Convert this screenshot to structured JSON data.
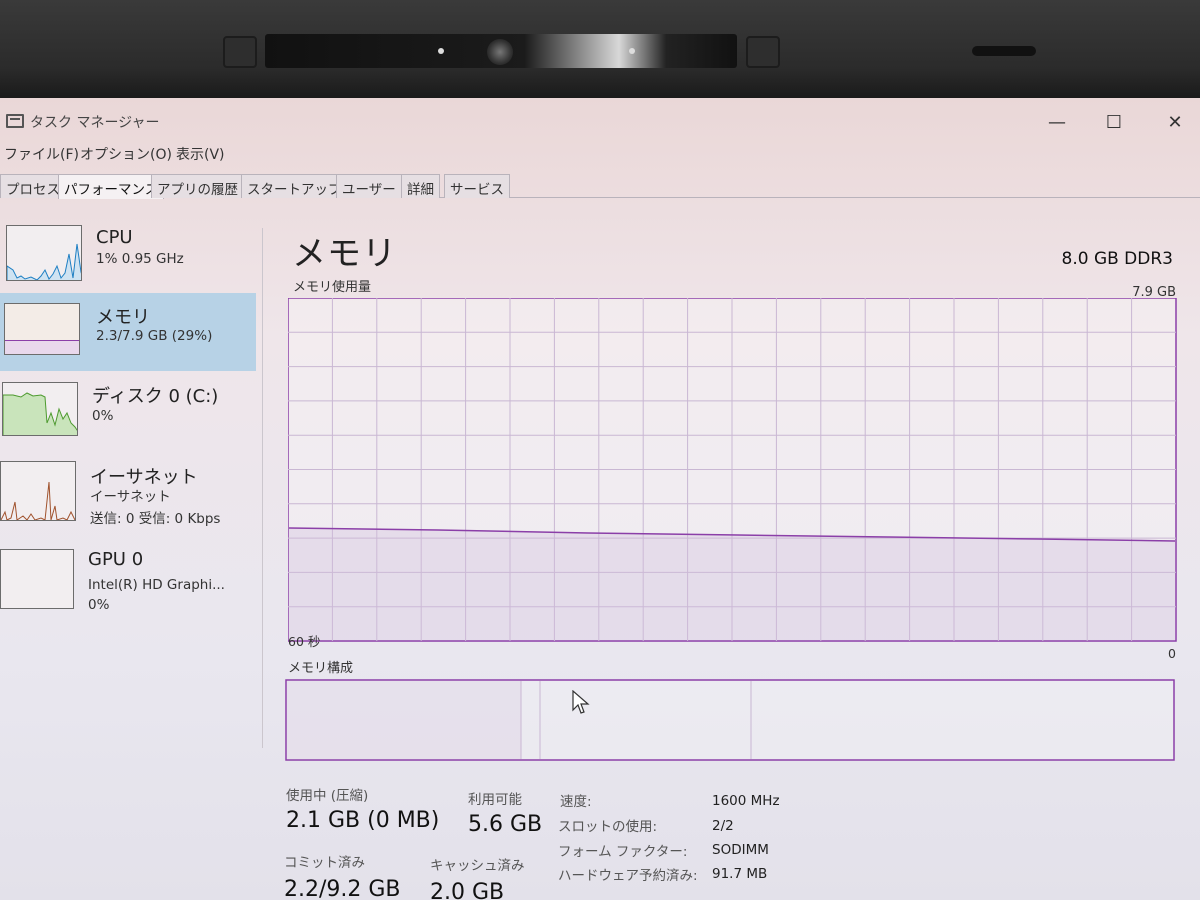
{
  "window": {
    "title": "タスク マネージャー",
    "controls": {
      "minimize": "—",
      "maximize": "☐",
      "close": "✕"
    }
  },
  "menu": [
    "ファイル(F)",
    "オプション(O)",
    "表示(V)"
  ],
  "tabs": [
    {
      "label": "プロセス",
      "active": false
    },
    {
      "label": "パフォーマンス",
      "active": true
    },
    {
      "label": "アプリの履歴",
      "active": false
    },
    {
      "label": "スタートアップ",
      "active": false
    },
    {
      "label": "ユーザー",
      "active": false
    },
    {
      "label": "詳細",
      "active": false
    },
    {
      "label": "サービス",
      "active": false
    }
  ],
  "sidebar": {
    "items": [
      {
        "name": "CPU",
        "lines": [
          "1%  0.95 GHz"
        ],
        "color": "#1e7fc3",
        "active": false
      },
      {
        "name": "メモリ",
        "lines": [
          "2.3/7.9 GB (29%)"
        ],
        "color": "#8b3fa8",
        "active": true
      },
      {
        "name": "ディスク 0 (C:)",
        "lines": [
          "0%"
        ],
        "color": "#4d9a2e",
        "active": false
      },
      {
        "name": "イーサネット",
        "lines": [
          "イーサネット",
          "送信: 0  受信: 0 Kbps"
        ],
        "color": "#a0522d",
        "active": false
      },
      {
        "name": "GPU 0",
        "lines": [
          "Intel(R) HD Graphi...",
          "0%"
        ],
        "color": "#1e7fc3",
        "active": false
      }
    ]
  },
  "main": {
    "title": "メモリ",
    "spec": "8.0 GB DDR3",
    "usage_chart_label": "メモリ使用量",
    "usage_chart_max": "7.9 GB",
    "axis_left": "60 秒",
    "axis_right": "0",
    "composition_label": "メモリ構成",
    "stats": {
      "in_use_label": "使用中 (圧縮)",
      "in_use_value": "2.1 GB (0 MB)",
      "available_label": "利用可能",
      "available_value": "5.6 GB",
      "committed_label": "コミット済み",
      "committed_value": "2.2/9.2 GB",
      "cached_label": "キャッシュ済み",
      "cached_value": "2.0 GB"
    },
    "details": [
      {
        "label": "速度:",
        "value": "1600 MHz"
      },
      {
        "label": "スロットの使用:",
        "value": "2/2"
      },
      {
        "label": "フォーム ファクター:",
        "value": "SODIMM"
      },
      {
        "label": "ハードウェア予約済み:",
        "value": "91.7 MB"
      }
    ]
  },
  "colors": {
    "memory_accent": "#8b3fa8",
    "grid": "#c9b7d3",
    "selected_bg": "#b7d2e6"
  }
}
